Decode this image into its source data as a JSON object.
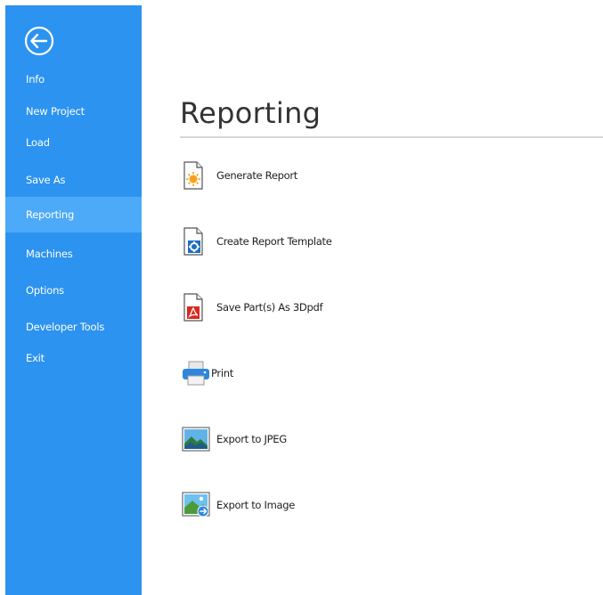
{
  "sidebar": {
    "back_icon": "back-arrow-circle-icon",
    "items": [
      {
        "label": "Info",
        "active": false
      },
      {
        "label": "New Project",
        "active": false
      },
      {
        "label": "Load",
        "active": false
      },
      {
        "label": "Save As",
        "active": false
      },
      {
        "label": "Reporting",
        "active": true
      },
      {
        "label": "Machines",
        "active": false
      },
      {
        "label": "Options",
        "active": false
      },
      {
        "label": "Developer Tools",
        "active": false
      },
      {
        "label": "Exit",
        "active": false
      }
    ],
    "colors": {
      "background": "#2c93f0",
      "active": "#4daaf8",
      "text": "#ffffff"
    }
  },
  "main": {
    "title": "Reporting",
    "actions": [
      {
        "label": "Generate Report",
        "icon": "document-star-icon"
      },
      {
        "label": "Create Report Template",
        "icon": "document-gear-icon"
      },
      {
        "label": "Save Part(s) As 3Dpdf",
        "icon": "pdf-document-icon"
      },
      {
        "label": "Print",
        "icon": "printer-icon"
      },
      {
        "label": "Export to JPEG",
        "icon": "landscape-image-icon"
      },
      {
        "label": "Export to Image",
        "icon": "image-export-icon"
      }
    ]
  }
}
